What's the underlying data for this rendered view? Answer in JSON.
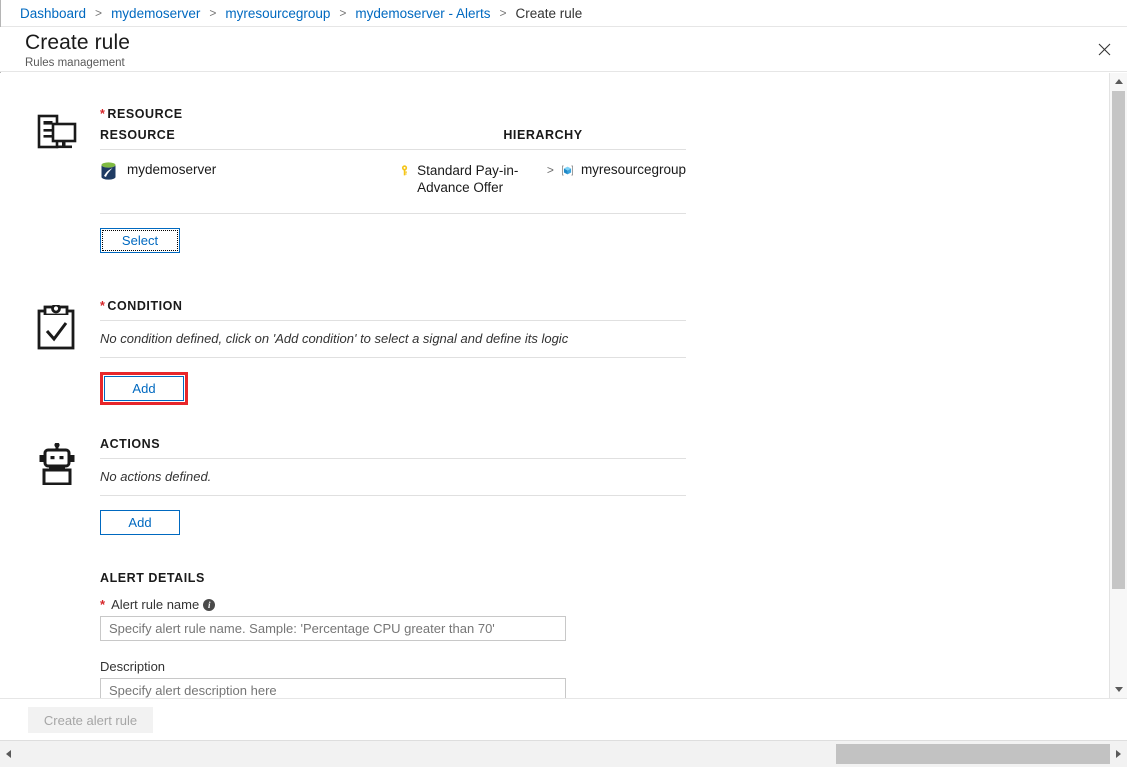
{
  "breadcrumb": {
    "items": [
      {
        "label": "Dashboard",
        "current": false
      },
      {
        "label": "mydemoserver",
        "current": false
      },
      {
        "label": "myresourcegroup",
        "current": false
      },
      {
        "label": "mydemoserver - Alerts",
        "current": false
      },
      {
        "label": "Create rule",
        "current": true
      }
    ],
    "separator": ">"
  },
  "blade": {
    "title": "Create rule",
    "subtitle": "Rules management",
    "close_icon": "close-icon"
  },
  "resource_section": {
    "icon": "server-monitor-icon",
    "title": "RESOURCE",
    "required": true,
    "required_marker": "*",
    "columns": {
      "resource": "RESOURCE",
      "hierarchy": "HIERARCHY"
    },
    "rows": [
      {
        "resource_icon": "sql-server-database-icon",
        "resource_name": "mydemoserver",
        "hierarchy": [
          {
            "icon": "key-icon",
            "label": "Standard Pay-in-Advance Offer"
          },
          {
            "icon": "resource-group-icon",
            "label": "myresourcegroup"
          }
        ],
        "hierarchy_separator": ">"
      }
    ],
    "select_button": "Select"
  },
  "condition_section": {
    "icon": "clipboard-check-icon",
    "title": "CONDITION",
    "required": true,
    "required_marker": "*",
    "empty_text": "No condition defined, click on 'Add condition' to select a signal and define its logic",
    "add_button": "Add",
    "highlighted": true,
    "highlight_color": "#e8262a"
  },
  "actions_section": {
    "icon": "robot-icon",
    "title": "ACTIONS",
    "required": false,
    "empty_text": "No actions defined.",
    "add_button": "Add"
  },
  "alert_details": {
    "title": "ALERT DETAILS",
    "fields": [
      {
        "label": "Alert rule name",
        "required": true,
        "required_marker": "*",
        "has_info_icon": true,
        "info_icon": "info-icon",
        "value": "",
        "placeholder": "Specify alert rule name. Sample: 'Percentage CPU greater than 70'"
      },
      {
        "label": "Description",
        "required": false,
        "has_info_icon": false,
        "value": "",
        "placeholder": "Specify alert description here"
      }
    ]
  },
  "footer": {
    "create_button": "Create alert rule",
    "create_button_enabled": false
  },
  "scrollbars": {
    "vertical": {
      "up_arrow": "chevron-up-icon",
      "down_arrow": "chevron-down-icon"
    },
    "horizontal": {
      "left_arrow": "chevron-left-icon",
      "right_arrow": "chevron-right-icon"
    }
  },
  "colors": {
    "link": "#0069c0",
    "required": "#d6272b",
    "highlight": "#e8262a",
    "text": "#333333",
    "border": "#e0e0e0"
  }
}
